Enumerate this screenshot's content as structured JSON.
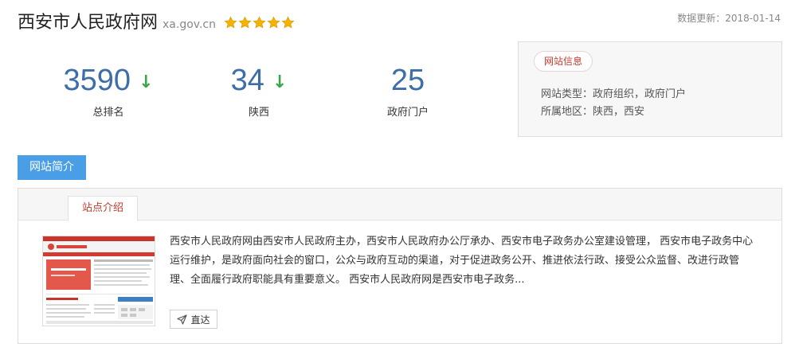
{
  "site": {
    "name": "西安市人民政府网",
    "domain": "xa.gov.cn",
    "rating": 5,
    "rating_max": 5,
    "star_icon": "star-icon",
    "update": "数据更新：2018-01-14"
  },
  "stats": [
    {
      "value": "3590",
      "label": "总排名",
      "trend": "down",
      "trend_icon": "arrow-down-icon"
    },
    {
      "value": "34",
      "label": "陕西",
      "trend": "down",
      "trend_icon": "arrow-down-icon"
    },
    {
      "value": "25",
      "label": "政府门户",
      "trend": ""
    }
  ],
  "info": {
    "badge": "网站信息",
    "type_row": "网站类型：政府组织，政府门户",
    "region_row": "所属地区：陕西，西安"
  },
  "section": {
    "tab": "网站简介",
    "panel_tab": "站点介绍",
    "description": "西安市人民政府网由西安市人民政府主办，西安市人民政府办公厅承办、西安市电子政务办公室建设管理， 西安市电子政务中心运行维护，是政府面向社会的窗口，公众与政府互动的渠道，对于促进政务公开、推进依法行政、接受公众监督、改进行政管理、全面履行政府职能具有重要意义。 西安市人民政府网是西安市电子政务...",
    "goto_label": "直达",
    "goto_icon": "send-icon"
  },
  "colors": {
    "accent_blue": "#4a9ee6",
    "number_blue": "#3d6ea8",
    "arrow_green": "#3aa54a",
    "badge_red": "#c23a2e",
    "star_gold": "#f5b301"
  }
}
